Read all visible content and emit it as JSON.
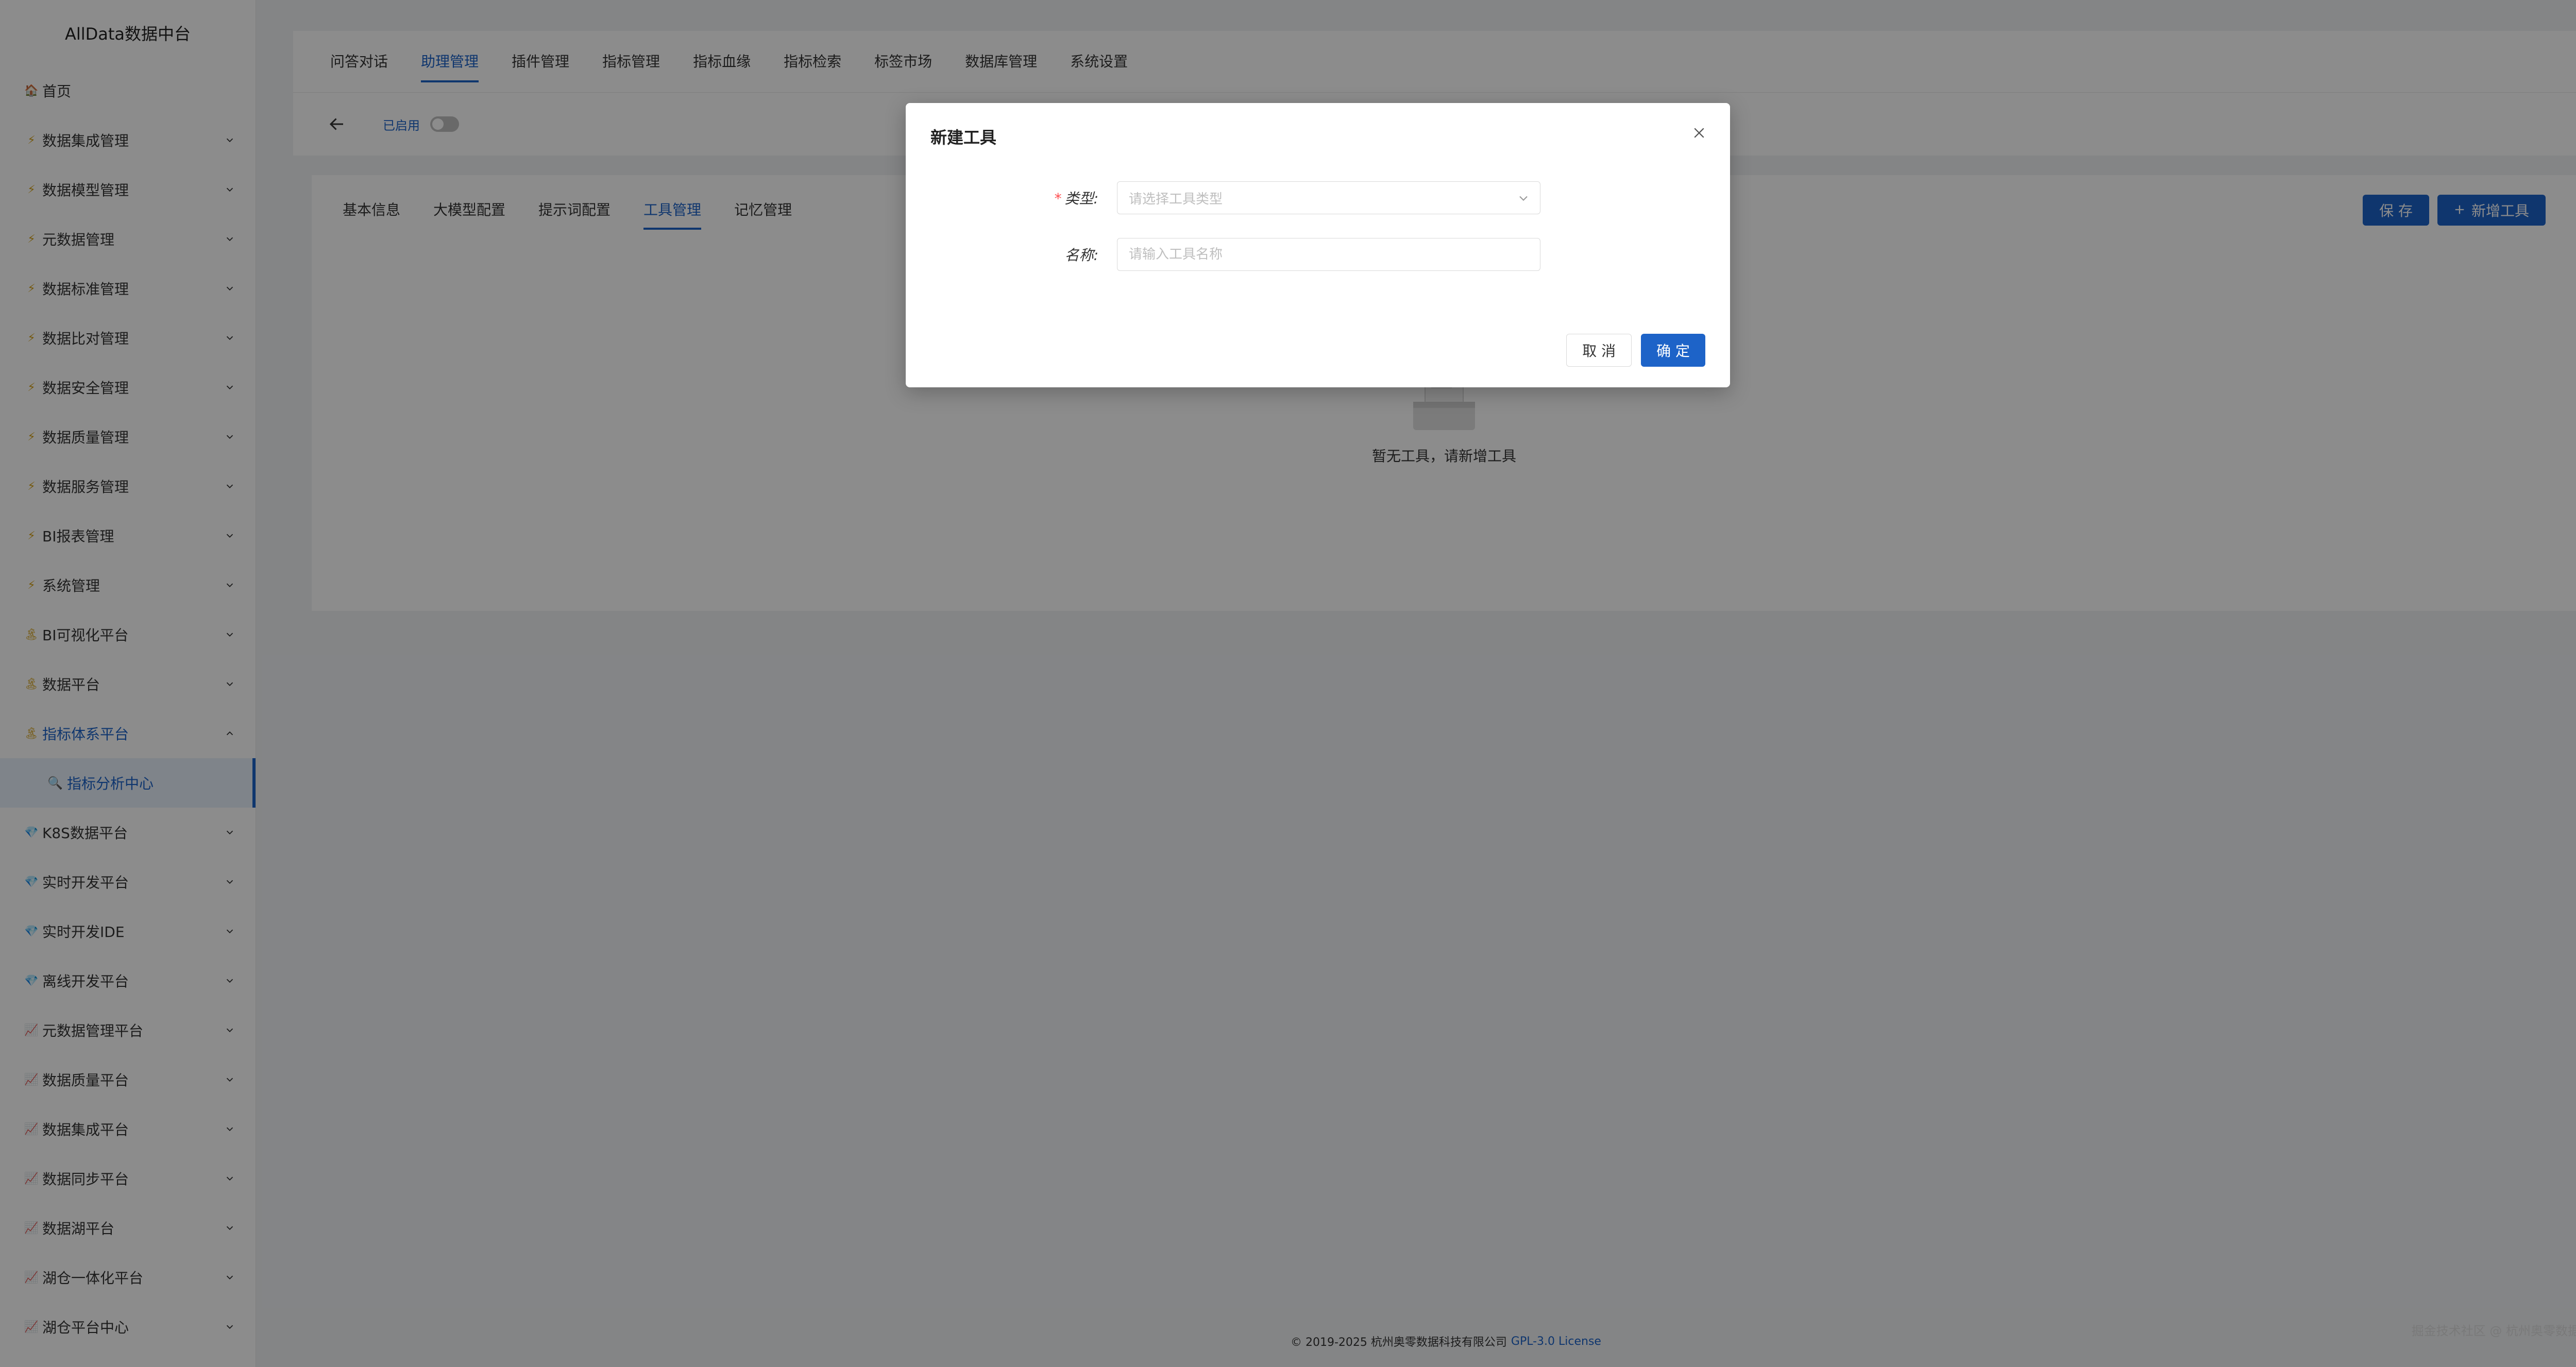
{
  "app": {
    "title": "AllData数据中台"
  },
  "sidebar": {
    "items": [
      {
        "label": "首页",
        "icon": "home-icon",
        "glyph": "🏠",
        "chevron": false
      },
      {
        "label": "数据集成管理",
        "icon": "lightning-icon",
        "glyph": "⚡",
        "chevron": true
      },
      {
        "label": "数据模型管理",
        "icon": "lightning-icon",
        "glyph": "⚡",
        "chevron": true
      },
      {
        "label": "元数据管理",
        "icon": "lightning-icon",
        "glyph": "⚡",
        "chevron": true
      },
      {
        "label": "数据标准管理",
        "icon": "lightning-icon",
        "glyph": "⚡",
        "chevron": true
      },
      {
        "label": "数据比对管理",
        "icon": "lightning-icon",
        "glyph": "⚡",
        "chevron": true
      },
      {
        "label": "数据安全管理",
        "icon": "lightning-icon",
        "glyph": "⚡",
        "chevron": true
      },
      {
        "label": "数据质量管理",
        "icon": "lightning-icon",
        "glyph": "⚡",
        "chevron": true
      },
      {
        "label": "数据服务管理",
        "icon": "lightning-icon",
        "glyph": "⚡",
        "chevron": true
      },
      {
        "label": "BI报表管理",
        "icon": "lightning-icon",
        "glyph": "⚡",
        "chevron": true
      },
      {
        "label": "系统管理",
        "icon": "lightning-icon",
        "glyph": "⚡",
        "chevron": true
      },
      {
        "label": "BI可视化平台",
        "icon": "palm-icon",
        "glyph": "🏝",
        "chevron": true
      },
      {
        "label": "数据平台",
        "icon": "palm-icon",
        "glyph": "🏝",
        "chevron": true
      },
      {
        "label": "指标体系平台",
        "icon": "palm-icon",
        "glyph": "🏝",
        "chevron": true,
        "open": true,
        "children": [
          {
            "label": "指标分析中心",
            "icon": "search-icon",
            "glyph": "🔍"
          }
        ]
      },
      {
        "label": "K8S数据平台",
        "icon": "diamond-icon",
        "glyph": "💎",
        "chevron": true
      },
      {
        "label": "实时开发平台",
        "icon": "diamond-icon",
        "glyph": "💎",
        "chevron": true
      },
      {
        "label": "实时开发IDE",
        "icon": "diamond-icon",
        "glyph": "💎",
        "chevron": true
      },
      {
        "label": "离线开发平台",
        "icon": "diamond-icon",
        "glyph": "💎",
        "chevron": true
      },
      {
        "label": "元数据管理平台",
        "icon": "chart-icon",
        "glyph": "📈",
        "chevron": true
      },
      {
        "label": "数据质量平台",
        "icon": "chart-icon",
        "glyph": "📈",
        "chevron": true
      },
      {
        "label": "数据集成平台",
        "icon": "chart-icon",
        "glyph": "📈",
        "chevron": true
      },
      {
        "label": "数据同步平台",
        "icon": "chart-icon",
        "glyph": "📈",
        "chevron": true
      },
      {
        "label": "数据湖平台",
        "icon": "chart-icon",
        "glyph": "📈",
        "chevron": true
      },
      {
        "label": "湖仓一体化平台",
        "icon": "chart-icon",
        "glyph": "📈",
        "chevron": true
      },
      {
        "label": "湖仓平台中心",
        "icon": "chart-icon",
        "glyph": "📈",
        "chevron": true
      }
    ]
  },
  "top_tabs": [
    {
      "label": "问答对话"
    },
    {
      "label": "助理管理",
      "active": true
    },
    {
      "label": "插件管理"
    },
    {
      "label": "指标管理"
    },
    {
      "label": "指标血缘"
    },
    {
      "label": "指标检索"
    },
    {
      "label": "标签市场"
    },
    {
      "label": "数据库管理"
    },
    {
      "label": "系统设置"
    }
  ],
  "header": {
    "enabled_label": "已启用",
    "toggle_on": false
  },
  "sub_tabs": [
    {
      "label": "基本信息"
    },
    {
      "label": "大模型配置"
    },
    {
      "label": "提示词配置"
    },
    {
      "label": "工具管理",
      "active": true
    },
    {
      "label": "记忆管理"
    }
  ],
  "actions": {
    "save_label": "保 存",
    "add_tool_label": "新增工具"
  },
  "empty": {
    "text": "暂无工具，请新增工具"
  },
  "modal": {
    "title": "新建工具",
    "type_label": "类型:",
    "type_placeholder": "请选择工具类型",
    "name_label": "名称:",
    "name_placeholder": "请输入工具名称",
    "cancel_label": "取 消",
    "ok_label": "确 定"
  },
  "footer": {
    "copyright": "© 2019-2025 杭州奥零数据科技有限公司",
    "license": "GPL-3.0 License",
    "watermark": "掘金技术社区 @ 杭州奥零数据科技"
  },
  "colors": {
    "primary": "#1d63c8",
    "required": "#ff4d4f",
    "overlay": "rgba(0,0,0,0.45)"
  }
}
